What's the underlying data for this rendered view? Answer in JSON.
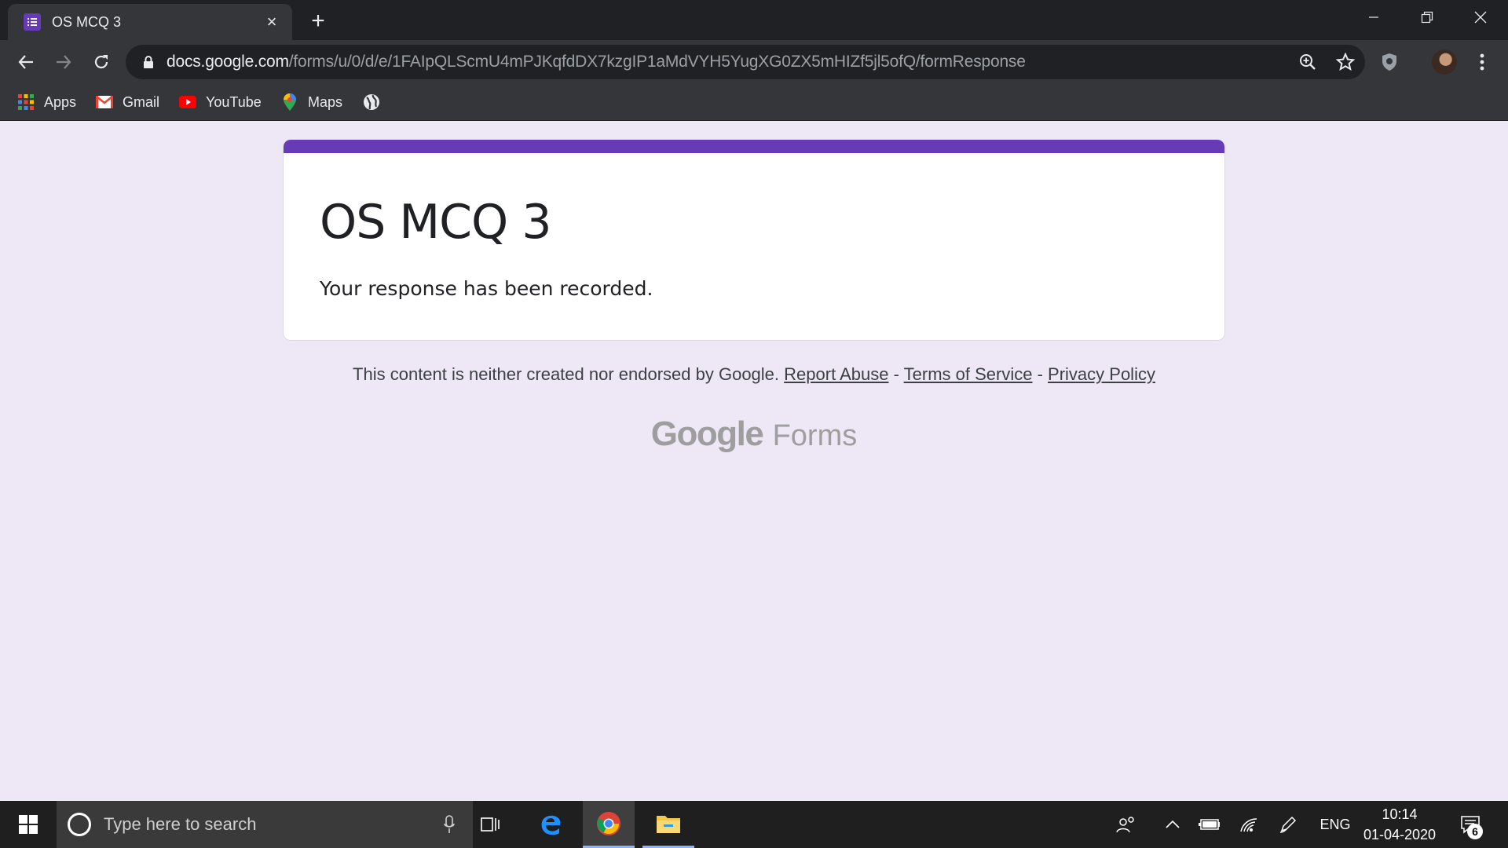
{
  "browser": {
    "tab": {
      "title": "OS MCQ 3",
      "favicon": "google-forms-icon",
      "close": "×"
    },
    "new_tab": "+",
    "window_controls": [
      "minimize",
      "restore",
      "close"
    ],
    "url": {
      "host": "docs.google.com",
      "path": "/forms/u/0/d/e/1FAIpQLScmU4mPJKqfdDX7kzgIP1aMdVYH5YugXG0ZX5mHIZf5jl5ofQ/formResponse"
    },
    "bookmarks": [
      {
        "label": "Apps",
        "icon": "apps-grid-icon"
      },
      {
        "label": "Gmail",
        "icon": "gmail-icon"
      },
      {
        "label": "YouTube",
        "icon": "youtube-icon"
      },
      {
        "label": "Maps",
        "icon": "maps-pin-icon"
      },
      {
        "label": "",
        "icon": "globe-icon"
      }
    ]
  },
  "form": {
    "title": "OS MCQ 3",
    "confirmation": "Your response has been recorded.",
    "accent_color": "#673ab7",
    "background_color": "#ede7f6"
  },
  "footer": {
    "disclaimer": "This content is neither created nor endorsed by Google.",
    "report_abuse": "Report Abuse",
    "separator": " - ",
    "terms": "Terms of Service",
    "privacy": "Privacy Policy",
    "brand_google": "Google",
    "brand_forms": "Forms"
  },
  "taskbar": {
    "search_placeholder": "Type here to search",
    "language": "ENG",
    "time": "10:14",
    "date": "01-04-2020",
    "notification_count": "6"
  }
}
